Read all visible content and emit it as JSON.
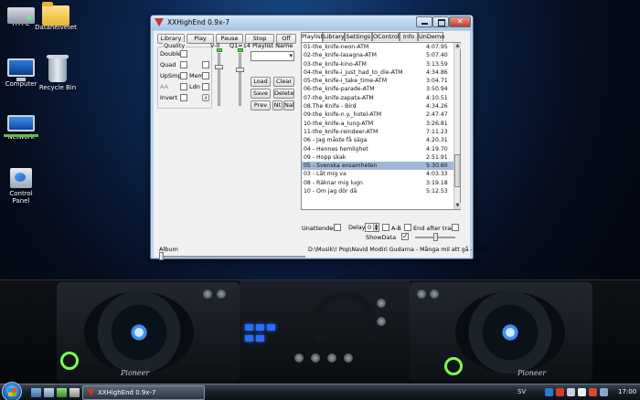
{
  "desktop": {
    "icons": [
      {
        "label": "HTPC",
        "icon": "drive-icon"
      },
      {
        "label": "Datahelvetet",
        "icon": "folder-icon"
      },
      {
        "label": "Computer",
        "icon": "computer-icon"
      },
      {
        "label": "Recycle Bin",
        "icon": "recycle-bin-icon"
      },
      {
        "label": "Network",
        "icon": "network-icon"
      },
      {
        "label": "Control Panel",
        "icon": "control-panel-icon"
      }
    ],
    "wallpaper_brand": "Pioneer"
  },
  "window": {
    "title": "XXHighEnd 0.9x-7",
    "buttons": {
      "library": "Library",
      "play": "Play",
      "pause": "Pause",
      "stop": "Stop",
      "off": "Off",
      "load": "Load",
      "clear": "Clear",
      "save": "Save",
      "delete": "Delete",
      "prev": "Prev",
      "nt": "Nt",
      "nal": "Nal"
    },
    "quality": {
      "label": "Quality",
      "options": [
        "Double",
        "Quad",
        "UpSmp",
        "AA",
        "Invert"
      ],
      "mem_label": "Mem",
      "ldn_label": "Ldn",
      "ldn_checked": false
    },
    "volume_label": "V-0",
    "q1_label": "Q1=14",
    "playlist_name_label": "Playlist Name",
    "playlist_name_value": "",
    "tabs": [
      "Playlist",
      "Library",
      "Settings",
      "OControl",
      "Info",
      "UnDemo"
    ],
    "active_tab": "Playlist",
    "playlist": [
      {
        "title": "01-the_knife-neon-ATM",
        "duration": "4:07.95"
      },
      {
        "title": "02-the_knife-lasagna-ATM",
        "duration": "5:07.40"
      },
      {
        "title": "03-the_knife-kino-ATM",
        "duration": "3:13.59"
      },
      {
        "title": "04-the_knife-i_just_had_to_die-ATM",
        "duration": "4:34.86"
      },
      {
        "title": "05-the_knife-i_take_time-ATM",
        "duration": "3:04.71"
      },
      {
        "title": "06-the_knife-parade-ATM",
        "duration": "3:50.94"
      },
      {
        "title": "07-the_knife-zapata-ATM",
        "duration": "4:10.51"
      },
      {
        "title": "08.The Knife - Bird",
        "duration": "4:34.26"
      },
      {
        "title": "09-the_knife-n.y._hotel-ATM",
        "duration": "2:47.47"
      },
      {
        "title": "10-the_knife-a_lung-ATM",
        "duration": "3:26.81"
      },
      {
        "title": "11-the_knife-reindeer-ATM",
        "duration": "7:11.23"
      },
      {
        "title": "06 - Jag måste få säga",
        "duration": "4:20.31"
      },
      {
        "title": "04 - Hennes hemlighet",
        "duration": "4:19.70"
      },
      {
        "title": "09 - Hopp skak",
        "duration": "2:51.91"
      },
      {
        "title": "05 - Svenska ensamheten",
        "duration": "5:30.60"
      },
      {
        "title": "03 - Låt mig va",
        "duration": "4:03.33"
      },
      {
        "title": "08 - Räknar mig lugn",
        "duration": "3:19.18"
      },
      {
        "title": "10 - Om jag dör då",
        "duration": "5:12.53"
      }
    ],
    "selected_index": 14,
    "bottom": {
      "unattended": "Unattended",
      "delay": "Delay",
      "delay_value": "0",
      "ab": "A-B",
      "end_after_track": "End after track",
      "show_data": "ShowData",
      "show_data_checked": true
    },
    "album_label": "Album",
    "status_path": "D:\\Musik\\! Pop\\Navid Modiri  Gudarna - Många mil att gå - 2006"
  },
  "taskbar": {
    "task_label": "XXHighEnd 0.9x-7",
    "language": "SV",
    "clock": "17:00"
  }
}
